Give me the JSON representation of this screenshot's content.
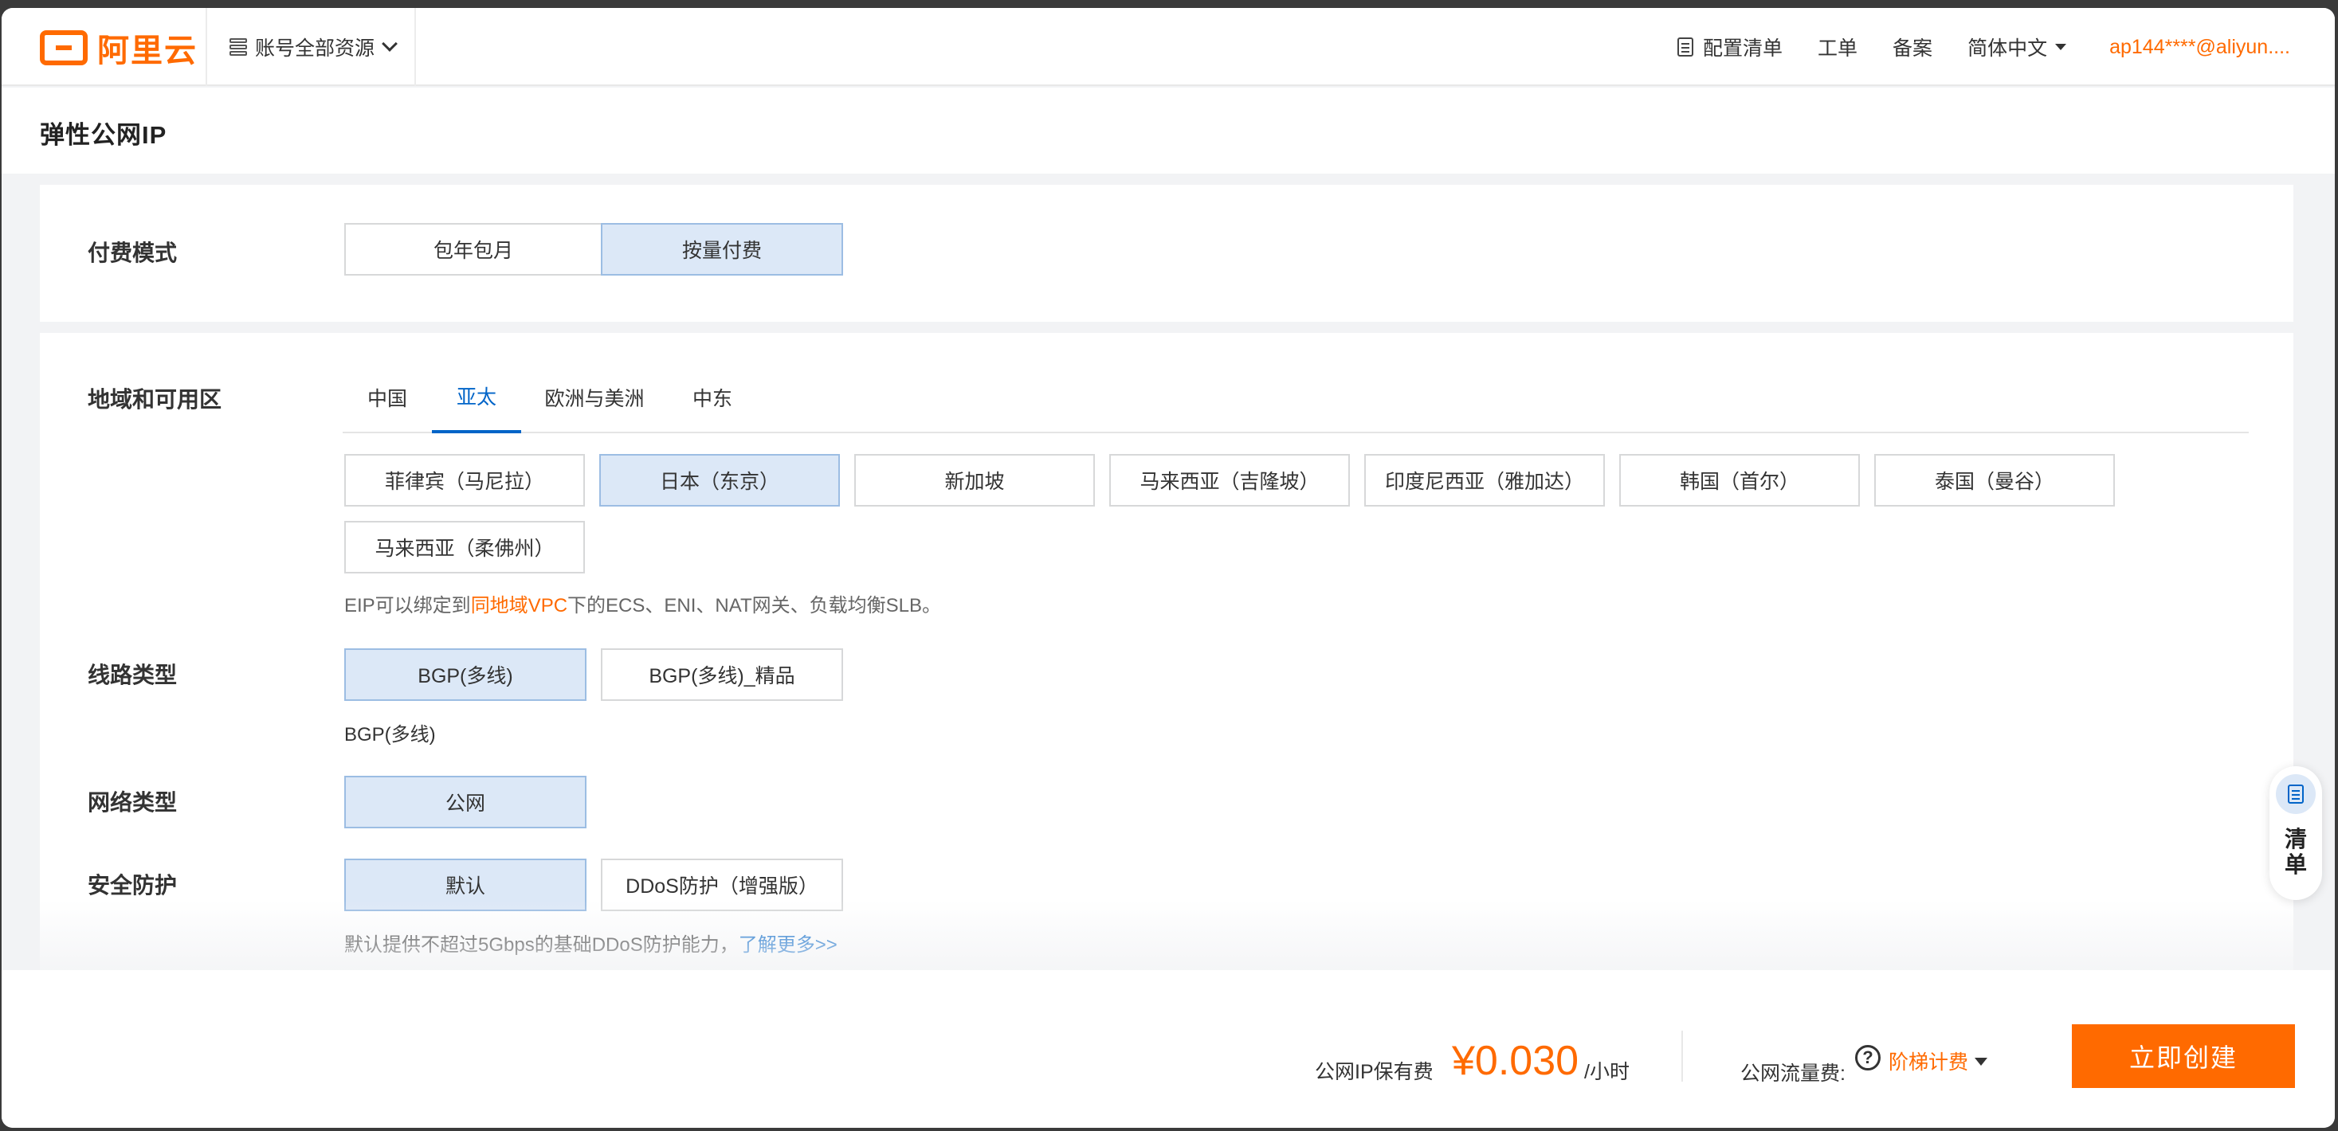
{
  "header": {
    "brand": "阿里云",
    "resource_switch": "账号全部资源",
    "nav": {
      "config_list": "配置清单",
      "tickets": "工单",
      "icp": "备案",
      "language": "简体中文",
      "user": "ap144****@aliyun...."
    }
  },
  "page": {
    "title": "弹性公网IP"
  },
  "billing": {
    "label": "付费模式",
    "options": [
      "包年包月",
      "按量付费"
    ],
    "selected": "按量付费"
  },
  "region": {
    "label": "地域和可用区",
    "tabs": [
      "中国",
      "亚太",
      "欧洲与美洲",
      "中东"
    ],
    "selected_tab": "亚太",
    "options": [
      "菲律宾（马尼拉）",
      "日本（东京）",
      "新加坡",
      "马来西亚（吉隆坡）",
      "印度尼西亚（雅加达）",
      "韩国（首尔）",
      "泰国（曼谷）",
      "马来西亚（柔佛州）"
    ],
    "selected": "日本（东京）",
    "hint_prefix": "EIP可以绑定到",
    "hint_link": "同地域VPC",
    "hint_suffix": "下的ECS、ENI、NAT网关、负载均衡SLB。"
  },
  "line_type": {
    "label": "线路类型",
    "options": [
      "BGP(多线)",
      "BGP(多线)_精品"
    ],
    "selected": "BGP(多线)",
    "hint": "BGP(多线)"
  },
  "network_type": {
    "label": "网络类型",
    "options": [
      "公网"
    ],
    "selected": "公网"
  },
  "security": {
    "label": "安全防护",
    "options": [
      "默认",
      "DDoS防护（增强版）"
    ],
    "selected": "默认",
    "hint": "默认提供不超过5Gbps的基础DDoS防护能力，",
    "hint_link": "了解更多>>"
  },
  "float_widget": {
    "label": "清单"
  },
  "footer": {
    "ip_fee_label": "公网IP保有费",
    "price": "¥0.030",
    "price_unit": "/小时",
    "traffic_fee_label": "公网流量费:",
    "help_glyph": "?",
    "tier_label": "阶梯计费",
    "create_button": "立即创建"
  },
  "colors": {
    "accent": "#ff6a00",
    "link": "#0064c8",
    "selected_bg": "#dce8f7"
  }
}
